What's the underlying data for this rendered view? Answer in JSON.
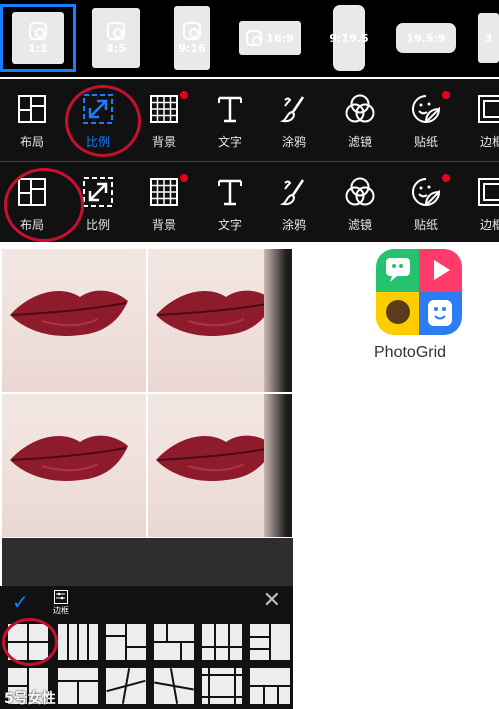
{
  "ratios": [
    {
      "label": "1:1",
      "icon": "camera-icon",
      "selected": true
    },
    {
      "label": "4:5",
      "icon": "camera-icon"
    },
    {
      "label": "9:16",
      "icon": "camera-icon"
    },
    {
      "label": "16:9",
      "icon": "camera-icon"
    },
    {
      "label": "9:19.5",
      "icon": "phone-icon"
    },
    {
      "label": "19.5:9",
      "icon": "phone-icon"
    },
    {
      "label": "3",
      "icon": "camera-icon"
    }
  ],
  "toolbar": [
    {
      "label": "布局",
      "icon": "layout-icon"
    },
    {
      "label": "比例",
      "icon": "ratio-icon",
      "active": true
    },
    {
      "label": "背景",
      "icon": "background-grid-icon",
      "dot": true
    },
    {
      "label": "文字",
      "icon": "text-icon"
    },
    {
      "label": "涂鸦",
      "icon": "brush-icon"
    },
    {
      "label": "滤镜",
      "icon": "filter-icon"
    },
    {
      "label": "贴纸",
      "icon": "sticker-icon",
      "dot": true
    },
    {
      "label": "边框",
      "icon": "frame-icon"
    }
  ],
  "toolbar2": [
    {
      "label": "布局",
      "icon": "layout-icon"
    },
    {
      "label": "比例",
      "icon": "ratio-icon"
    },
    {
      "label": "背景",
      "icon": "background-grid-icon",
      "dot": true
    },
    {
      "label": "文字",
      "icon": "text-icon"
    },
    {
      "label": "涂鸦",
      "icon": "brush-icon"
    },
    {
      "label": "滤镜",
      "icon": "filter-icon"
    },
    {
      "label": "贴纸",
      "icon": "sticker-icon",
      "dot": true
    },
    {
      "label": "边框",
      "icon": "frame-icon"
    }
  ],
  "panel": {
    "confirm_icon": "check-icon",
    "border_label": "边框",
    "close_icon": "close-icon"
  },
  "app": {
    "name": "PhotoGrid"
  },
  "watermark": "5号女性",
  "colors": {
    "accent": "#1a7cff",
    "badge": "#e8001c",
    "annotation": "#c8102e",
    "lip": "#8e1b2b"
  }
}
